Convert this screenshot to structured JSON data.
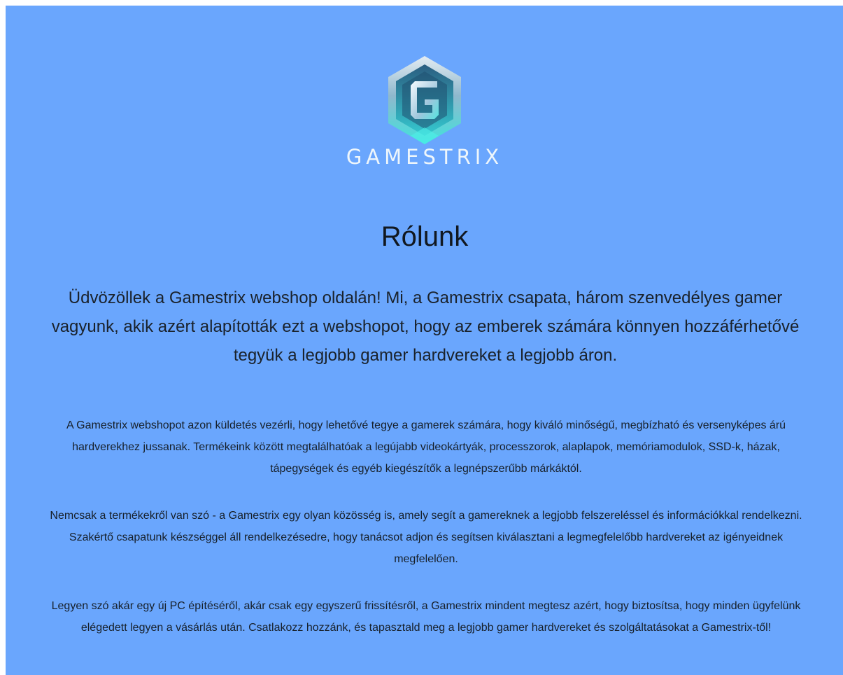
{
  "brand": {
    "wordmark": "GAMESTRIX",
    "emblem_letter": "G"
  },
  "about": {
    "title": "Rólunk",
    "lead": "Üdvözöllek a Gamestrix webshop oldalán! Mi, a Gamestrix csapata, három szenvedélyes gamer vagyunk, akik azért alapították ezt a webshopot, hogy az emberek számára könnyen hozzáférhetővé tegyük a legjobb gamer hardvereket a legjobb áron.",
    "paragraphs": [
      "A Gamestrix webshopot azon küldetés vezérli, hogy lehetővé tegye a gamerek számára, hogy kiváló minőségű, megbízható és versenyképes árú hardverekhez jussanak. Termékeink között megtalálhatóak a legújabb videokártyák, processzorok, alaplapok, memóriamodulok, SSD-k, házak, tápegységek és egyéb kiegészítők a legnépszerűbb márkáktól.",
      "Nemcsak a termékekről van szó - a Gamestrix egy olyan közösség is, amely segít a gamereknek a legjobb felszereléssel és információkkal rendelkezni. Szakértő csapatunk készséggel áll rendelkezésedre, hogy tanácsot adjon és segítsen kiválasztani a legmegfelelőbb hardvereket az igényeidnek megfelelően.",
      "Legyen szó akár egy új PC építéséről, akár csak egy egyszerű frissítésről, a Gamestrix mindent megtesz azért, hogy biztosítsa, hogy minden ügyfelünk elégedett legyen a vásárlás után. Csatlakozz hozzánk, és tapasztald meg a legjobb gamer hardvereket és szolgáltatásokat a Gamestrix-től!"
    ]
  },
  "colors": {
    "page_background": "#6aa6fd",
    "text": "#17202a",
    "logo_teal": "#41dcd6"
  },
  "icons": [
    "gamestrix-emblem-icon"
  ]
}
